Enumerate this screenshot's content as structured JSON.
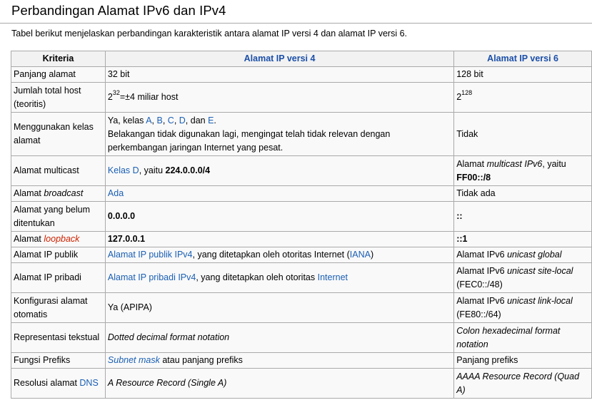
{
  "heading": "Perbandingan Alamat IPv6 dan IPv4",
  "intro": "Tabel berikut menjelaskan perbandingan karakteristik antara alamat IP versi 4 dan alamat IP versi 6.",
  "table": {
    "headers": [
      "Kriteria",
      "Alamat IP versi 4",
      "Alamat IP versi 6"
    ],
    "rows": [
      {
        "kriteria": "Panjang alamat",
        "ipv4": "32 bit",
        "ipv6": "128 bit"
      },
      {
        "kriteria": "Jumlah total host (teoritis)",
        "ipv4_base": "2",
        "ipv4_exp": "32",
        "ipv4_rest": "=±4 miliar host",
        "ipv6_base": "2",
        "ipv6_exp": "128"
      },
      {
        "kriteria": "Menggunakan kelas alamat",
        "ipv4_pre": "Ya, kelas ",
        "class_a": "A",
        "comma1": ", ",
        "class_b": "B",
        "comma2": ", ",
        "class_c": "C",
        "comma3": ", ",
        "class_d": "D",
        "dan": ", dan ",
        "class_e": "E",
        "period": ".",
        "ipv4_line2": "Belakangan tidak digunakan lagi, mengingat telah tidak relevan dengan perkembangan jaringan Internet yang pesat.",
        "ipv6": "Tidak"
      },
      {
        "kriteria": "Alamat multicast",
        "ipv4_link": "Kelas D",
        "ipv4_mid": ", yaitu ",
        "ipv4_bold": "224.0.0.0/4",
        "ipv6_pre": "Alamat ",
        "ipv6_italic": "multicast IPv6",
        "ipv6_mid": ", yaitu ",
        "ipv6_bold": "FF00::/8"
      },
      {
        "kriteria_pre": "Alamat ",
        "kriteria_italic": "broadcast",
        "ipv4_link": "Ada",
        "ipv6": "Tidak ada"
      },
      {
        "kriteria": "Alamat yang belum ditentukan",
        "ipv4_bold": "0.0.0.0",
        "ipv6_bold": "::"
      },
      {
        "kriteria_pre": "Alamat ",
        "kriteria_red": "loopback",
        "ipv4_bold": "127.0.0.1",
        "ipv6_bold": "::1"
      },
      {
        "kriteria": "Alamat IP publik",
        "ipv4_link": "Alamat IP publik IPv4",
        "ipv4_mid": ", yang ditetapkan oleh otoritas Internet (",
        "ipv4_link2": "IANA",
        "ipv4_end": ")",
        "ipv6_pre": "Alamat IPv6 ",
        "ipv6_italic": "unicast global"
      },
      {
        "kriteria": "Alamat IP pribadi",
        "ipv4_link": "Alamat IP pribadi IPv4",
        "ipv4_mid": ", yang ditetapkan oleh otoritas ",
        "ipv4_link2": "Internet",
        "ipv6_pre": "Alamat IPv6 ",
        "ipv6_italic": "unicast site-local",
        "ipv6_end": "(FEC0::/48)"
      },
      {
        "kriteria": "Konfigurasi alamat otomatis",
        "ipv4": "Ya (APIPA)",
        "ipv6_pre": "Alamat IPv6 ",
        "ipv6_italic": "unicast link-local",
        "ipv6_end": "(FE80::/64)"
      },
      {
        "kriteria": "Representasi tekstual",
        "ipv4_italic": "Dotted decimal format notation",
        "ipv6_italic": "Colon hexadecimal format notation"
      },
      {
        "kriteria": "Fungsi Prefiks",
        "ipv4_link_italic": "Subnet mask",
        "ipv4_mid": " atau panjang prefiks",
        "ipv6": "Panjang prefiks"
      },
      {
        "kriteria_pre": "Resolusi alamat ",
        "kriteria_link": "DNS",
        "ipv4_italic": "A Resource Record (Single A)",
        "ipv6_italic": "AAAA Resource Record (Quad A)"
      }
    ]
  }
}
